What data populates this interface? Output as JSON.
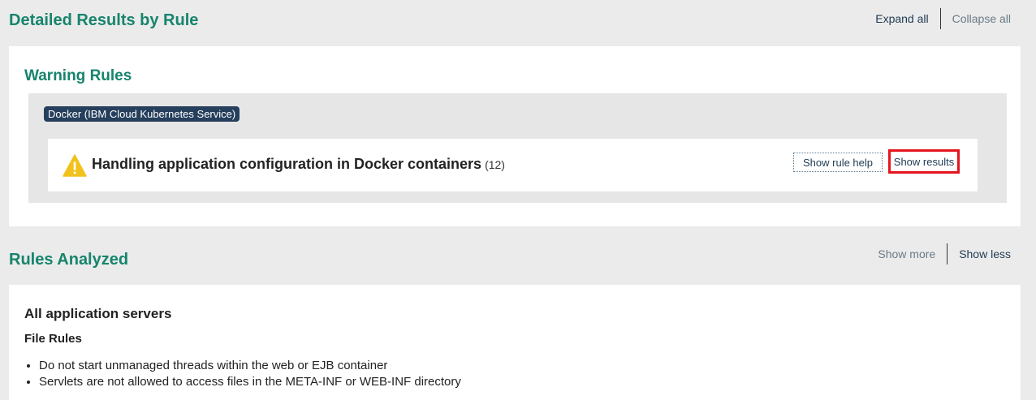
{
  "detailed_results": {
    "title": "Detailed Results by Rule",
    "expand_all": "Expand all",
    "collapse_all": "Collapse all",
    "warning_section": {
      "title": "Warning Rules",
      "group_tag": "Docker (IBM Cloud Kubernetes Service)",
      "rule": {
        "title": "Handling application configuration in Docker containers",
        "count": "(12)",
        "icon": "warning-triangle-icon",
        "show_rule_help": "Show rule help",
        "show_results": "Show results"
      }
    }
  },
  "rules_analyzed": {
    "title": "Rules Analyzed",
    "show_more": "Show more",
    "show_less": "Show less",
    "server_group": "All application servers",
    "category": "File Rules",
    "items": [
      "Do not start unmanaged threads within the web or EJB container",
      "Servlets are not allowed to access files in the META-INF or WEB-INF directory"
    ]
  },
  "colors": {
    "heading_green": "#17846d",
    "tag_navy": "#253f5c",
    "highlight_red": "#e5141d",
    "warning_yellow": "#f1c21b"
  }
}
